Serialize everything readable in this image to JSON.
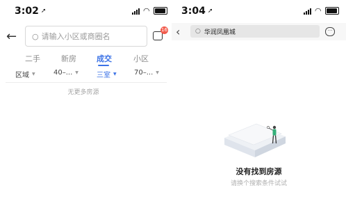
{
  "left": {
    "status_time": "3:02",
    "search_placeholder": "请输入小区或商圈名",
    "message_badge": "16",
    "tabs": [
      {
        "label": "二手"
      },
      {
        "label": "新房"
      },
      {
        "label": "成交"
      },
      {
        "label": "小区"
      }
    ],
    "filters": [
      {
        "label": "区域"
      },
      {
        "label": "40–..."
      },
      {
        "label": "三室"
      },
      {
        "label": "70–..."
      }
    ],
    "no_more_text": "无更多房源"
  },
  "right": {
    "status_time": "3:04",
    "search_query": "华润凤凰城",
    "empty_title": "没有找到房源",
    "empty_subtitle": "请换个搜索条件试试"
  },
  "colors": {
    "accent": "#3b72e6",
    "badge": "#f25b4c"
  }
}
